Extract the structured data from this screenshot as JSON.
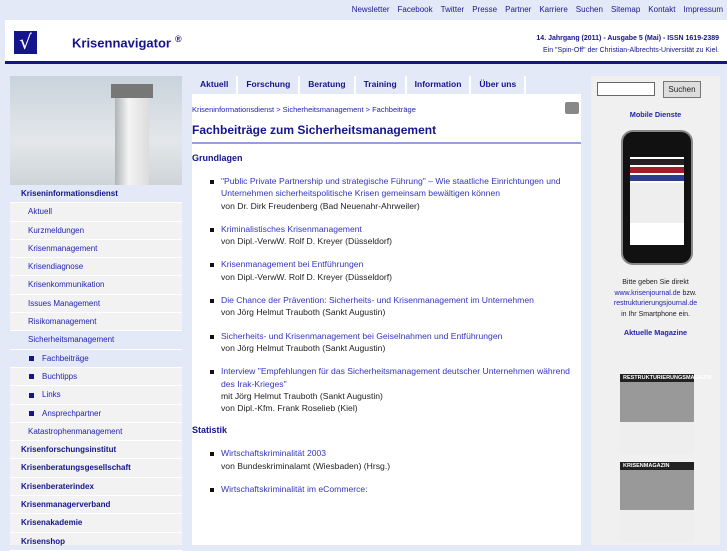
{
  "topnav": [
    "Newsletter",
    "Facebook",
    "Twitter",
    "Presse",
    "Partner",
    "Karriere",
    "Suchen",
    "Sitemap",
    "Kontakt",
    "Impressum"
  ],
  "header": {
    "brand": "Krisennavigator",
    "reg": "®",
    "issue": "14. Jahrgang (2011) - Ausgabe 5 (Mai) - ISSN 1619-2389",
    "spinoff": "Ein \"Spin-Off\" der Christian-Albrechts-Universität zu Kiel."
  },
  "menu": [
    "Aktuell",
    "Forschung",
    "Beratung",
    "Training",
    "Information",
    "Über uns"
  ],
  "sidebar": [
    {
      "label": "Kriseninformationsdienst",
      "level": "top",
      "selected": true
    },
    {
      "label": "Aktuell",
      "level": "sub"
    },
    {
      "label": "Kurzmeldungen",
      "level": "sub"
    },
    {
      "label": "Krisenmanagement",
      "level": "sub"
    },
    {
      "label": "Krisendiagnose",
      "level": "sub"
    },
    {
      "label": "Krisenkommunikation",
      "level": "sub"
    },
    {
      "label": "Issues Management",
      "level": "sub"
    },
    {
      "label": "Risikomanagement",
      "level": "sub"
    },
    {
      "label": "Sicherheitsmanagement",
      "level": "sub",
      "selected": true
    },
    {
      "label": "Fachbeiträge",
      "level": "sub2",
      "selected": true
    },
    {
      "label": "Buchtipps",
      "level": "sub2"
    },
    {
      "label": "Links",
      "level": "sub2"
    },
    {
      "label": "Ansprechpartner",
      "level": "sub2"
    },
    {
      "label": "Katastrophenmanagement",
      "level": "sub"
    },
    {
      "label": "Krisenforschungsinstitut",
      "level": "top"
    },
    {
      "label": "Krisenberatungsgesellschaft",
      "level": "top"
    },
    {
      "label": "Krisenberaterindex",
      "level": "top"
    },
    {
      "label": "Krisenmanagerverband",
      "level": "top"
    },
    {
      "label": "Krisenakademie",
      "level": "top"
    },
    {
      "label": "Krisenshop",
      "level": "top"
    }
  ],
  "breadcrumb": "Kriseninformationsdienst > Sicherheitsmanagement > Fachbeiträge",
  "title": "Fachbeiträge zum Sicherheitsmanagement",
  "sections": [
    {
      "heading": "Grundlagen",
      "items": [
        {
          "title": "\"Public Private Partnership und strategische Führung\" – Wie staatliche Einrichtungen und Unternehmen sicherheitspolitische Krisen gemeinsam bewältigen können",
          "authors": [
            "von Dr. Dirk Freudenberg (Bad Neuenahr-Ahrweiler)"
          ]
        },
        {
          "title": "Kriminalistisches Krisenmanagement",
          "authors": [
            "von Dipl.-VerwW. Rolf D. Kreyer (Düsseldorf)"
          ]
        },
        {
          "title": "Krisenmanagement bei Entführungen",
          "authors": [
            "von Dipl.-VerwW. Rolf D. Kreyer (Düsseldorf)"
          ]
        },
        {
          "title": "Die Chance der Prävention: Sicherheits- und Krisenmanagement im Unternehmen",
          "authors": [
            "von Jörg Helmut Trauboth (Sankt Augustin)"
          ]
        },
        {
          "title": "Sicherheits- und Krisenmanagement bei Geiselnahmen und Entführungen",
          "authors": [
            "von Jörg Helmut Trauboth (Sankt Augustin)"
          ]
        },
        {
          "title": "Interview \"Empfehlungen für das Sicherheitsmanagement deutscher Unternehmen während des Irak-Krieges\"",
          "authors": [
            "mit Jörg Helmut Trauboth (Sankt Augustin)",
            "von Dipl.-Kfm. Frank Roselieb (Kiel)"
          ]
        }
      ]
    },
    {
      "heading": "Statistik",
      "items": [
        {
          "title": "Wirtschaftskriminalität 2003",
          "authors": [
            "von Bundeskriminalamt (Wiesbaden) (Hrsg.)"
          ]
        },
        {
          "title": "Wirtschaftskriminalität im eCommerce:",
          "authors": []
        }
      ]
    }
  ],
  "right": {
    "search_value": "",
    "search_button": "Suchen",
    "mobile_heading": "Mobile Dienste",
    "mobile_text1": "Bitte geben Sie direkt",
    "link1": "www.krisenjournal.de",
    "mobile_text2": "bzw.",
    "link2": "restrukturierungsjournal.de",
    "mobile_text3": "in Ihr Smartphone ein.",
    "magazines_heading": "Aktuelle Magazine",
    "mag1": "RESTRUKTURIERUNGSMAGAZIN",
    "mag2": "KRISENMAGAZIN"
  }
}
